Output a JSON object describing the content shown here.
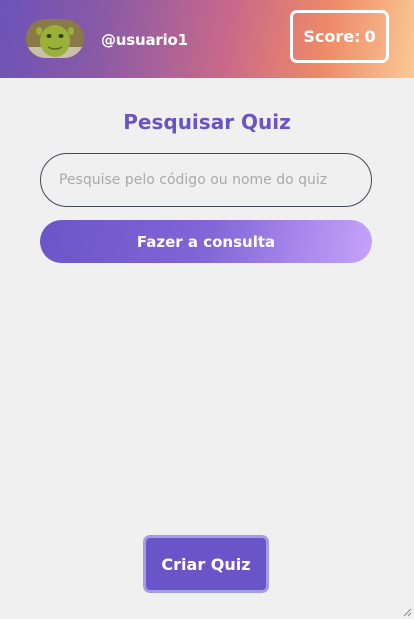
{
  "header": {
    "username": "@usuario1",
    "score_label": "Score:",
    "score_value": "0",
    "avatar_icon": "ogre-avatar-icon",
    "gradient_colors": [
      "#6c52b8",
      "#ee8a68",
      "#fbc994"
    ]
  },
  "main": {
    "title": "Pesquisar Quiz",
    "search_placeholder": "Pesquise pelo código ou nome do quiz",
    "search_value": "",
    "consult_button_label": "Fazer a consulta"
  },
  "footer": {
    "create_button_label": "Criar Quiz"
  },
  "colors": {
    "accent": "#6a55c8",
    "background": "#f0f0f0"
  }
}
